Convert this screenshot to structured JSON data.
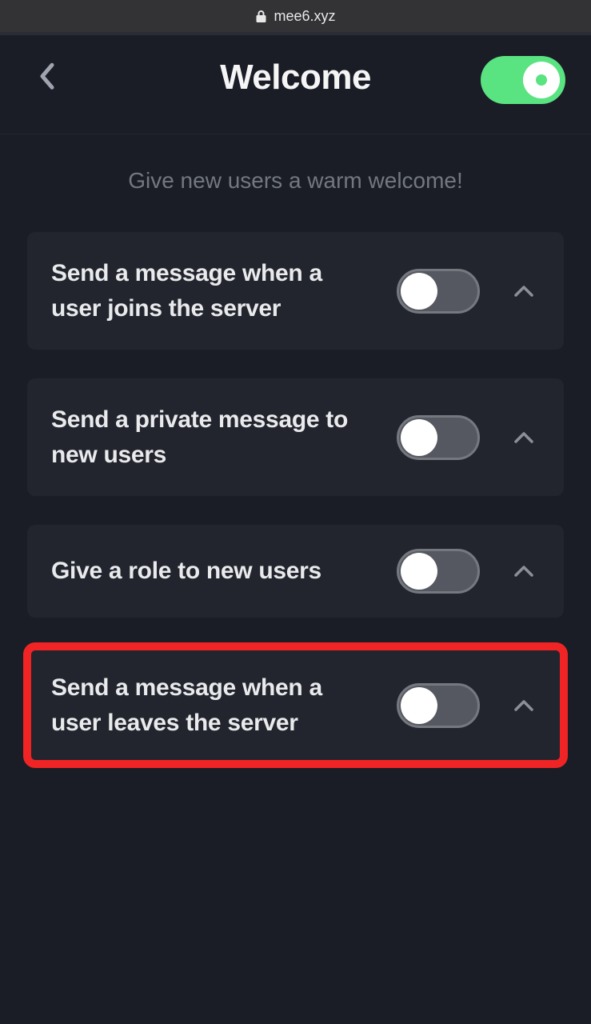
{
  "browser": {
    "url": "mee6.xyz"
  },
  "header": {
    "title": "Welcome",
    "main_toggle_on": true
  },
  "subtitle": "Give new users a warm welcome!",
  "settings": [
    {
      "label": "Send a message when a user joins the server",
      "enabled": false,
      "highlighted": false
    },
    {
      "label": "Send a private message to new users",
      "enabled": false,
      "highlighted": false
    },
    {
      "label": "Give a role to new users",
      "enabled": false,
      "highlighted": false
    },
    {
      "label": "Send a message when a user leaves the server",
      "enabled": false,
      "highlighted": true
    }
  ]
}
